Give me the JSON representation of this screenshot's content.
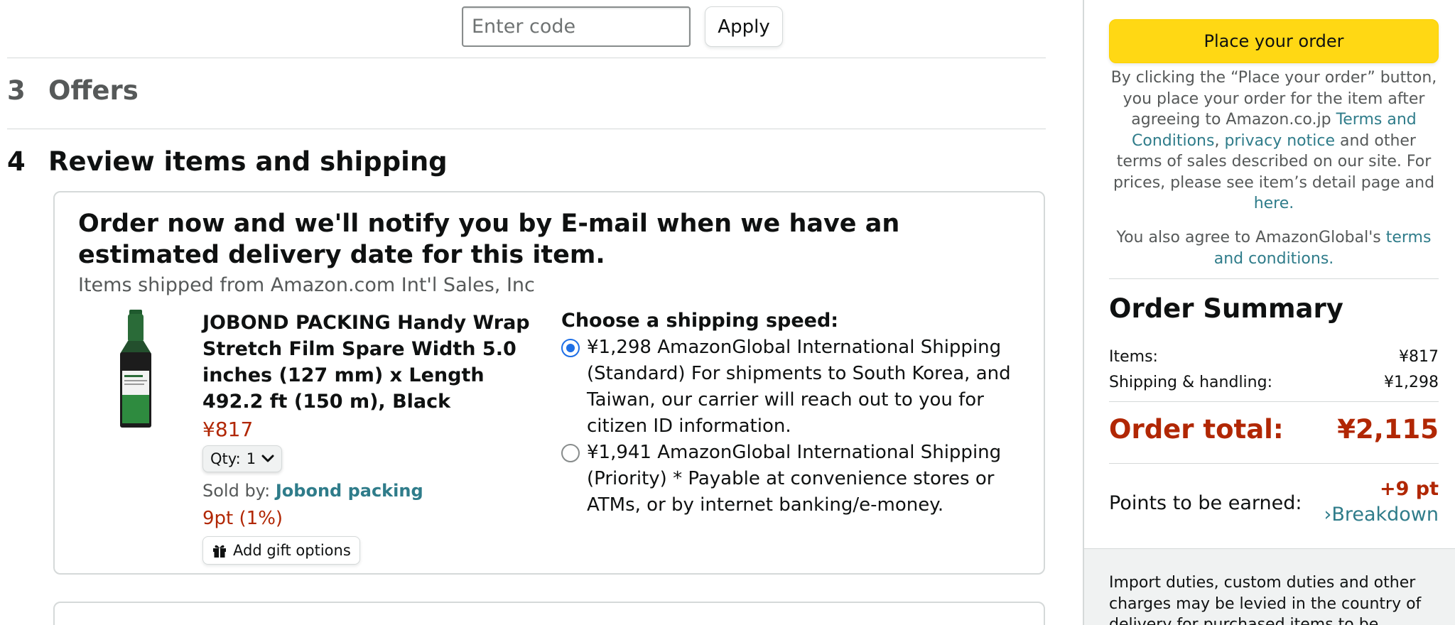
{
  "promo": {
    "placeholder": "Enter code",
    "apply_label": "Apply"
  },
  "sections": {
    "offers": {
      "number": "3",
      "label": "Offers"
    },
    "review": {
      "number": "4",
      "label": "Review items and shipping"
    }
  },
  "review": {
    "notice": "Order now and we'll notify you by E-mail when we have an estimated delivery date for this item.",
    "shipped_from": "Items shipped from Amazon.com Int'l Sales, Inc",
    "product": {
      "title": "JOBOND PACKING Handy Wrap Stretch Film Spare Width 5.0 inches (127 mm) x Length 492.2 ft (150 m), Black",
      "price": "¥817",
      "qty_label": "Qty:",
      "qty_value": "1",
      "sold_by_label": "Sold by:",
      "seller": "Jobond packing",
      "points": "9pt (1%)",
      "gift_label": "Add gift options",
      "image_icon": "product-bottle-icon"
    },
    "shipping": {
      "title": "Choose a shipping speed:",
      "options": [
        {
          "text": "¥1,298 AmazonGlobal International Shipping (Standard) For shipments to South Korea, and Taiwan, our carrier will reach out to you for citizen ID information.",
          "selected": true
        },
        {
          "text": "¥1,941 AmazonGlobal International Shipping (Priority) * Payable at convenience stores or ATMs, or by internet banking/e-money.",
          "selected": false
        }
      ]
    }
  },
  "sidebar": {
    "place_order_label": "Place your order",
    "legal": {
      "part1": "By clicking the “Place your order” button, you place your order for the item after agreeing to Amazon.co.jp ",
      "terms_link": "Terms and Conditions",
      "comma": ", ",
      "privacy_link": "privacy notice",
      "part2": " and other terms of sales described on our site. For prices, please see item’s detail page and ",
      "here_link": "here",
      "period": "."
    },
    "legal2": {
      "part1": "You also agree to AmazonGlobal's ",
      "terms_link": "terms and conditions",
      "period": "."
    },
    "summary": {
      "title": "Order Summary",
      "items_label": "Items:",
      "items_value": "¥817",
      "shipping_label": "Shipping & handling:",
      "shipping_value": "¥1,298",
      "total_label": "Order total:",
      "total_value": "¥2,115",
      "points_label": "Points to be earned:",
      "points_value": "+9 pt",
      "breakdown_label": "›Breakdown"
    },
    "import_note": "Import duties, custom duties and other charges may be levied in the country of delivery for purchased items to be"
  },
  "colors": {
    "accent_yellow": "#ffd814",
    "price_red": "#b12704",
    "link_teal": "#2f7c8a",
    "radio_blue": "#1e6fe6"
  }
}
